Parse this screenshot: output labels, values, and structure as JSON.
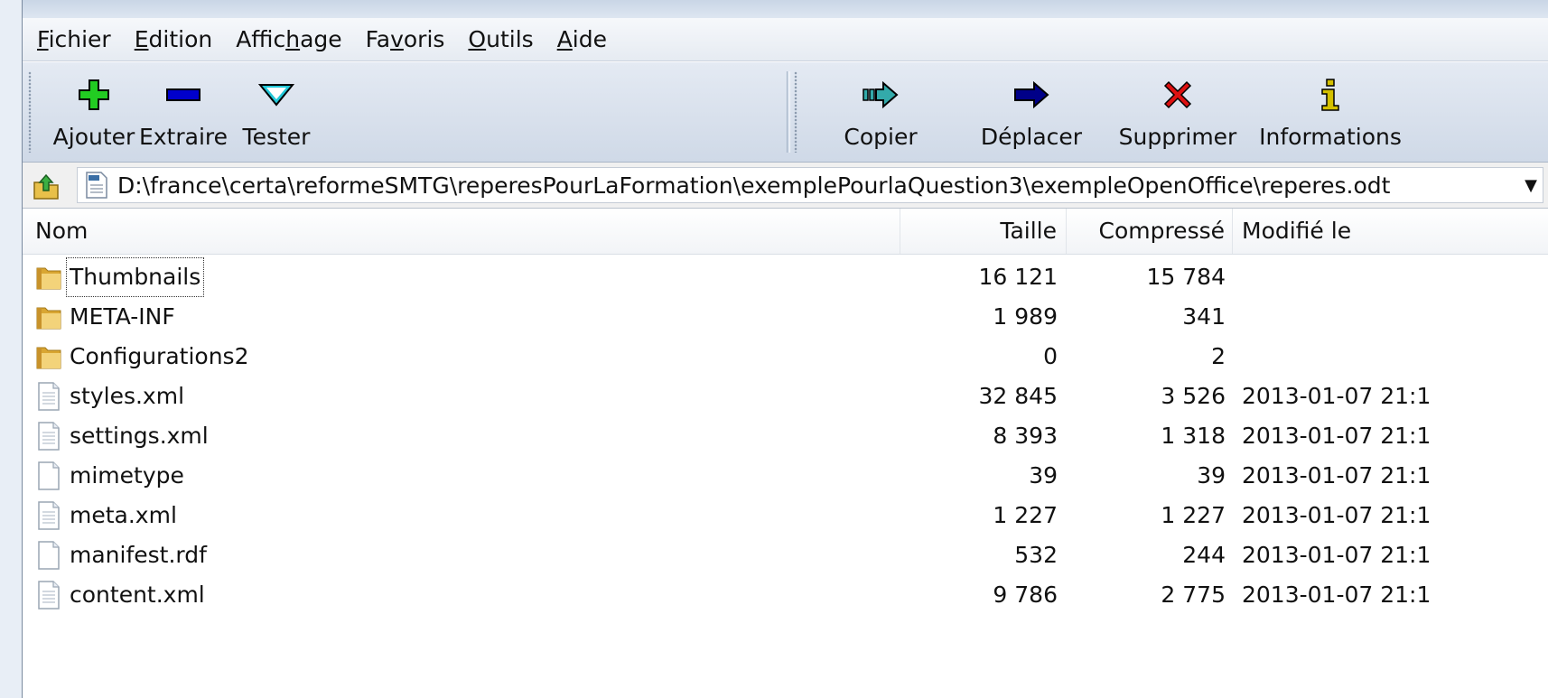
{
  "menu": [
    {
      "pre": "",
      "acc": "F",
      "post": "ichier"
    },
    {
      "pre": "",
      "acc": "E",
      "post": "dition"
    },
    {
      "pre": "Affic",
      "acc": "h",
      "post": "age"
    },
    {
      "pre": "Fa",
      "acc": "v",
      "post": "oris"
    },
    {
      "pre": "",
      "acc": "O",
      "post": "utils"
    },
    {
      "pre": "",
      "acc": "A",
      "post": "ide"
    }
  ],
  "toolbar": {
    "add_label": "Ajouter",
    "extract_label": "Extraire",
    "test_label": "Tester",
    "copy_label": "Copier",
    "move_label": "Déplacer",
    "delete_label": "Supprimer",
    "info_label": "Informations",
    "colors": {
      "add": "#22cc22",
      "extract": "#0000cc",
      "test": "#22c8d8",
      "copy": "#33aaaa",
      "move": "#000088",
      "delete": "#dd1111",
      "info": "#d4c000"
    }
  },
  "address": {
    "path": "D:\\france\\certa\\reformeSMTG\\reperesPourLaFormation\\exemplePourlaQuestion3\\exempleOpenOffice\\reperes.odt",
    "dropdown_icon": "▼",
    "file_icon_label": "ODT"
  },
  "columns": {
    "name": "Nom",
    "size": "Taille",
    "packed": "Compressé",
    "modified": "Modifié le"
  },
  "files": [
    {
      "name": "Thumbnails",
      "size": "16 121",
      "packed": "15 784",
      "modified": "",
      "type": "folder",
      "focused": true
    },
    {
      "name": "META-INF",
      "size": "1 989",
      "packed": "341",
      "modified": "",
      "type": "folder"
    },
    {
      "name": "Configurations2",
      "size": "0",
      "packed": "2",
      "modified": "",
      "type": "folder"
    },
    {
      "name": "styles.xml",
      "size": "32 845",
      "packed": "3 526",
      "modified": "2013-01-07 21:1",
      "type": "file"
    },
    {
      "name": "settings.xml",
      "size": "8 393",
      "packed": "1 318",
      "modified": "2013-01-07 21:1",
      "type": "file"
    },
    {
      "name": "mimetype",
      "size": "39",
      "packed": "39",
      "modified": "2013-01-07 21:1",
      "type": "blank"
    },
    {
      "name": "meta.xml",
      "size": "1 227",
      "packed": "1 227",
      "modified": "2013-01-07 21:1",
      "type": "file"
    },
    {
      "name": "manifest.rdf",
      "size": "532",
      "packed": "244",
      "modified": "2013-01-07 21:1",
      "type": "blank"
    },
    {
      "name": "content.xml",
      "size": "9 786",
      "packed": "2 775",
      "modified": "2013-01-07 21:1",
      "type": "file"
    }
  ]
}
